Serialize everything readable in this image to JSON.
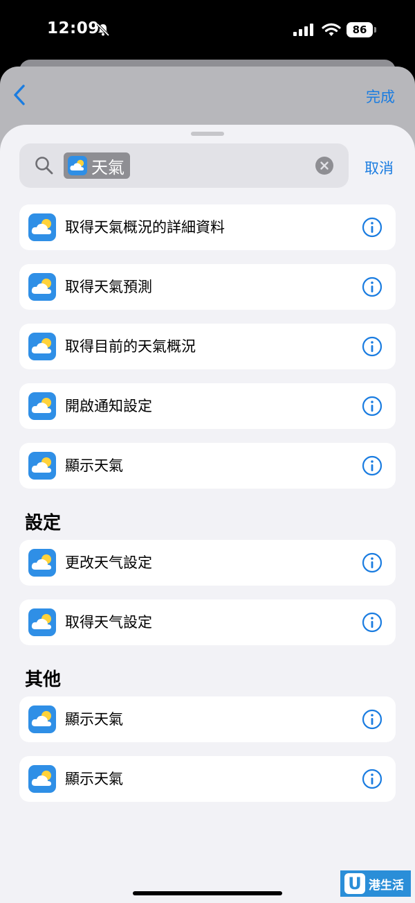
{
  "status_bar": {
    "time": "12:09",
    "battery": "86"
  },
  "nav": {
    "done_label": "完成"
  },
  "search": {
    "token_label": "天氣",
    "cancel_label": "取消"
  },
  "groups": [
    {
      "header": "",
      "items": [
        "取得天氣概況的詳細資料",
        "取得天氣預測",
        "取得目前的天氣概況",
        "開啟通知設定",
        "顯示天氣"
      ]
    },
    {
      "header": "設定",
      "items": [
        "更改天气設定",
        "取得天气設定"
      ]
    },
    {
      "header": "其他",
      "items": [
        "顯示天氣",
        "顯示天氣"
      ]
    }
  ],
  "icons": {
    "weather_app_icon": "weather-app-icon",
    "info": "info-icon",
    "search": "search-icon",
    "clear": "clear-icon"
  },
  "colors": {
    "accent": "#1a7ce0",
    "sheet_bg": "#f2f2f6",
    "row_bg": "#ffffff"
  },
  "watermark": {
    "text": "港生活",
    "logo_letter": "U"
  }
}
